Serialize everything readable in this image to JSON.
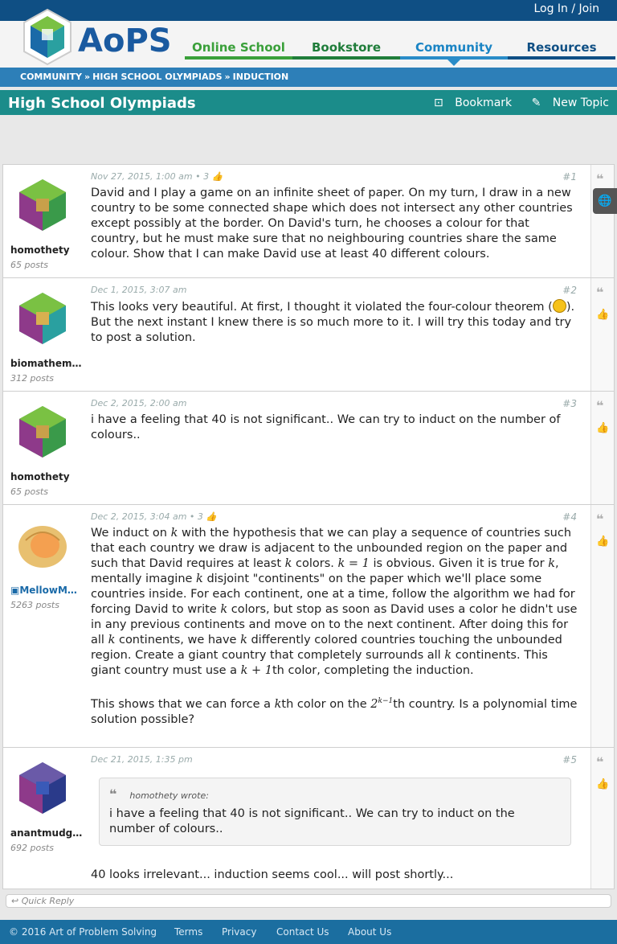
{
  "header": {
    "login": "Log In / Join",
    "logo_text": "AoPS",
    "nav": [
      "Online School",
      "Bookstore",
      "Community",
      "Resources"
    ]
  },
  "breadcrumb": [
    "COMMUNITY",
    "HIGH SCHOOL OLYMPIADS",
    "INDUCTION"
  ],
  "forum": {
    "title": "High School Olympiads",
    "bookmark": "Bookmark",
    "new_topic": "New Topic"
  },
  "posts": [
    {
      "user": "homothety",
      "posts": "65 posts",
      "date": "Nov 27, 2015, 1:00 am",
      "likes": "• 3",
      "num": "#1",
      "text": "David and I play a game on an infinite sheet of paper. On my turn, I draw in a new country to be some connected shape which does not intersect any other countries except possibly at the border. On David's turn, he chooses a colour for that country, but he must make sure that no neighbouring countries share the same colour. Show that I can make David use at least 40 different colours."
    },
    {
      "user": "biomathema...",
      "posts": "312 posts",
      "date": "Dec 1, 2015, 3:07 am",
      "num": "#2",
      "text_a": "This looks very beautiful. At first, I thought it violated the four-colour theorem (",
      "text_b": "). But the next instant I knew there is so much more to it. I will try this today and try to post a solution."
    },
    {
      "user": "homothety",
      "posts": "65 posts",
      "date": "Dec 2, 2015, 2:00 am",
      "num": "#3",
      "text": "i have a feeling that 40 is not significant.. We can try to induct on the number of colours.."
    },
    {
      "user": "MellowMelon",
      "posts": "5263 posts",
      "date": "Dec 2, 2015, 3:04 am",
      "likes": "• 3",
      "num": "#4"
    },
    {
      "user": "anantmudga...",
      "posts": "692 posts",
      "date": "Dec 21, 2015, 1:35 pm",
      "num": "#5",
      "quote_who": "homothety wrote:",
      "quote_text": "i have a feeling that 40 is not significant.. We can try to induct on the number of colours..",
      "text": "40 looks irrelevant... induction seems cool... will post shortly..."
    }
  ],
  "quick_reply": "Quick Reply",
  "footer": {
    "copyright": "© 2016 Art of Problem Solving",
    "links": [
      "Terms",
      "Privacy",
      "Contact Us",
      "About Us"
    ]
  },
  "colors": {
    "topbar": "#0f4f84",
    "forumbar": "#1b8c8a",
    "crumbs": "#2d7fb8"
  }
}
